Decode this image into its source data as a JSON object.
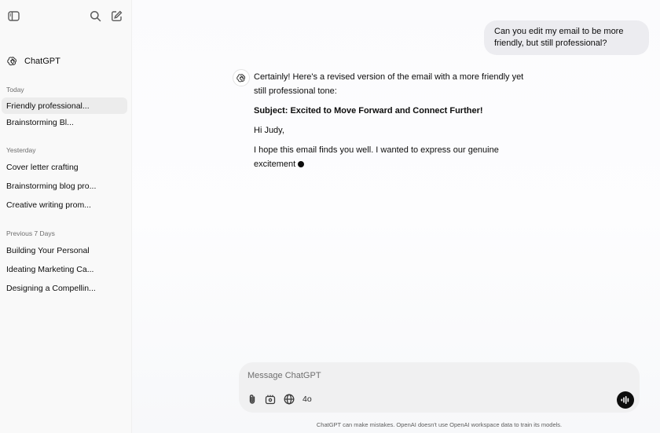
{
  "app": {
    "name": "ChatGPT"
  },
  "sidebar": {
    "sections": [
      {
        "label": "Today",
        "items": [
          "Friendly professional...",
          "Brainstorming Bl..."
        ]
      },
      {
        "label": "Yesterday",
        "items": [
          "Cover letter crafting",
          "Brainstorming blog pro...",
          "Creative writing prom..."
        ]
      },
      {
        "label": "Previous 7 Days",
        "items": [
          "Building Your Personal",
          "Ideating Marketing Ca...",
          "Designing a Compellin..."
        ]
      }
    ],
    "active_item": "Friendly professional..."
  },
  "conversation": {
    "user_message": "Can you edit my email to be more friendly, but still professional?",
    "assistant": {
      "intro": "Certainly! Here's a revised version of the email with a more friendly yet still professional tone:",
      "subject": "Subject: Excited to Move Forward and Connect Further!",
      "greeting": "Hi Judy,",
      "body": "I hope this email finds you well. I wanted to express our genuine excitement"
    }
  },
  "composer": {
    "placeholder": "Message ChatGPT",
    "value": "",
    "model": "4o"
  },
  "footer": {
    "disclaimer": "ChatGPT can make mistakes. OpenAI doesn't use OpenAI workspace data to train its models."
  },
  "icons": {
    "sidebar_toggle": "sidebar-toggle-icon",
    "search": "search-icon",
    "new_chat": "compose-icon",
    "logo": "openai-logo-icon",
    "attach": "paperclip-icon",
    "tools": "tools-icon",
    "web": "globe-icon",
    "voice": "voice-waveform-icon"
  },
  "colors": {
    "user_bubble": "#ececf0",
    "active_item": "#ececec",
    "composer": "#f0f0f1",
    "voice_button": "#0d0d0d"
  }
}
